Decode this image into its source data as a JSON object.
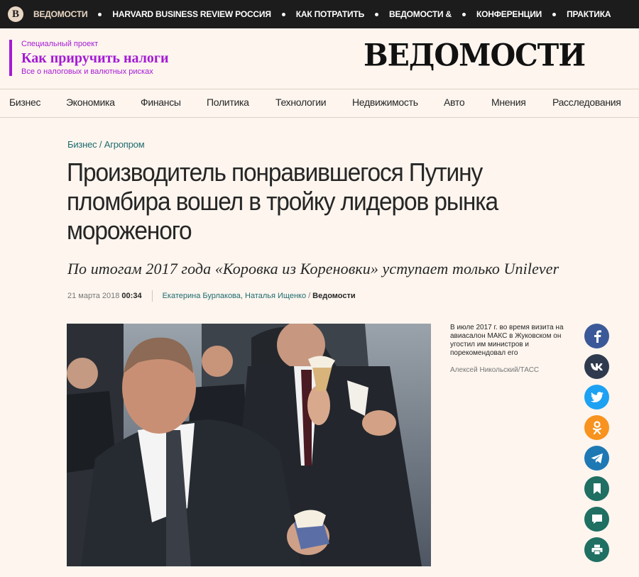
{
  "topbar": {
    "items": [
      "ВЕДОМОСТИ",
      "HARVARD BUSINESS REVIEW РОССИЯ",
      "КАК ПОТРАТИТЬ",
      "ВЕДОМОСТИ &",
      "КОНФЕРЕНЦИИ",
      "ПРАКТИКА"
    ]
  },
  "promo": {
    "label": "Специальный проект",
    "title": "Как приручить налоги",
    "subtitle": "Все о налоговых и валютных рисках"
  },
  "brand": {
    "name": "ВЕДОМОСТИ"
  },
  "sections": [
    "Бизнес",
    "Экономика",
    "Финансы",
    "Политика",
    "Технологии",
    "Недвижимость",
    "Авто",
    "Мнения",
    "Расследования"
  ],
  "article": {
    "rubric_main": "Бизнес",
    "rubric_sub": "Агропром",
    "headline": "Производитель понравившегося Путину пломбира вошел в тройку лидеров рынка мороженого",
    "subtitle": "По итогам 2017 года «Коровка из Кореновки» уступает только Unilever",
    "date": "21 марта 2018",
    "time": "00:34",
    "authors": "Екатерина Бурлакова, Наталья Ищенко",
    "source": "Ведомости",
    "photo_caption": "В июле 2017 г. во время визита на авиасалон МАКС в Жуковском он угостил им министров и порекомендовал его",
    "photo_credit": "Алексей Никольский/ТАСС"
  },
  "share": [
    {
      "icon": "facebook-icon",
      "color": "#3b5998"
    },
    {
      "icon": "vk-icon",
      "color": "#2f3a4e"
    },
    {
      "icon": "twitter-icon",
      "color": "#1da1f2"
    },
    {
      "icon": "odnoklassniki-icon",
      "color": "#f7931e"
    },
    {
      "icon": "telegram-icon",
      "color": "#1e78b4"
    },
    {
      "icon": "bookmark-icon",
      "color": "#1f6f63"
    },
    {
      "icon": "comment-icon",
      "color": "#1f6f63"
    },
    {
      "icon": "print-icon",
      "color": "#1f6f63"
    }
  ]
}
